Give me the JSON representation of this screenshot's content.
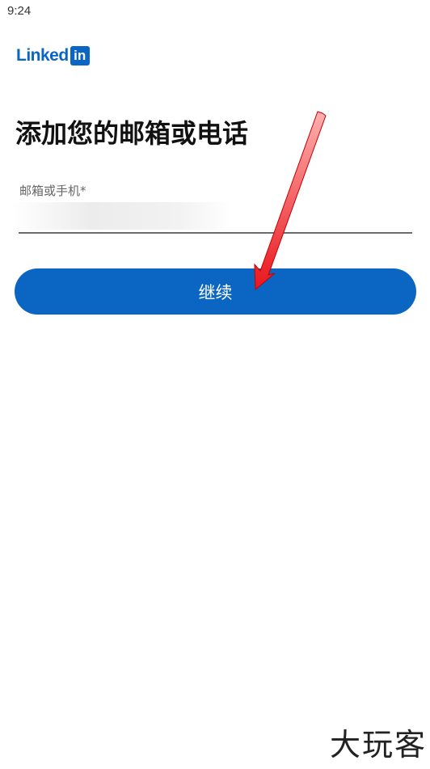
{
  "status_bar": {
    "time": "9:24"
  },
  "brand": {
    "name": "Linked",
    "badge": "in",
    "color": "#0a66c2"
  },
  "page": {
    "title": "添加您的邮箱或电话"
  },
  "form": {
    "field_label": "邮箱或手机*",
    "field_value": "",
    "continue_label": "继续"
  },
  "annotation": {
    "arrow_color": "#e8161c"
  },
  "watermark": {
    "text": "大玩客"
  }
}
